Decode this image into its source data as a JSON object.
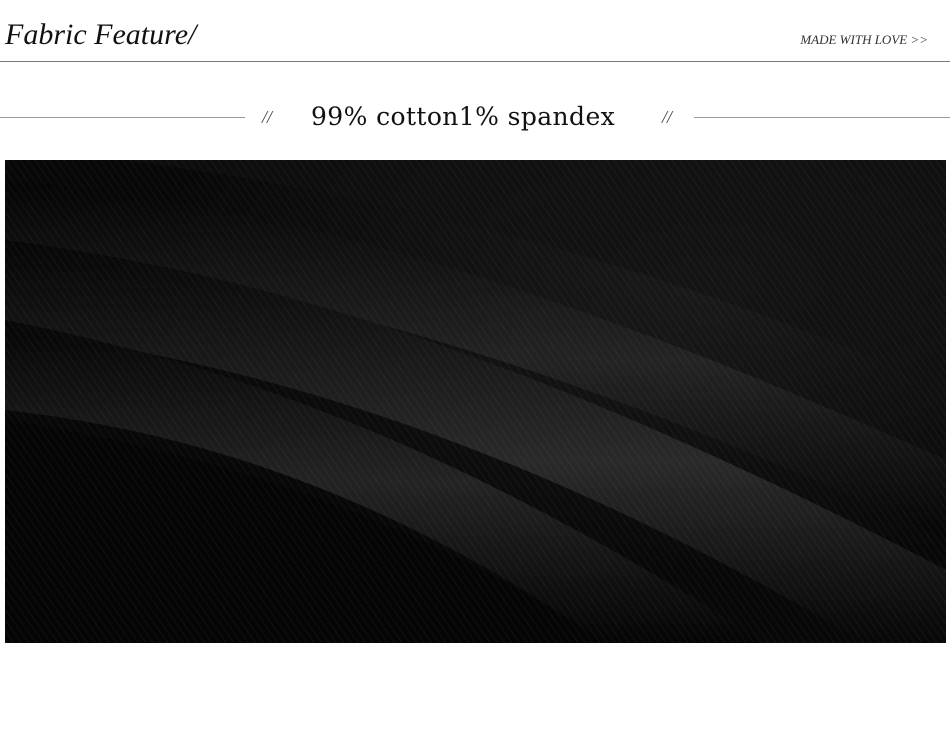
{
  "header": {
    "title": "Fabric Feature/",
    "tagline": "MADE WITH LOVE >>"
  },
  "feature": {
    "divider_left": "//",
    "text": "99% cotton1% spandex",
    "divider_right": "//"
  },
  "image": {
    "subject": "black twill fabric folds",
    "colors": {
      "base": "#0b0b0b",
      "highlight": "#2c2c2c"
    }
  }
}
